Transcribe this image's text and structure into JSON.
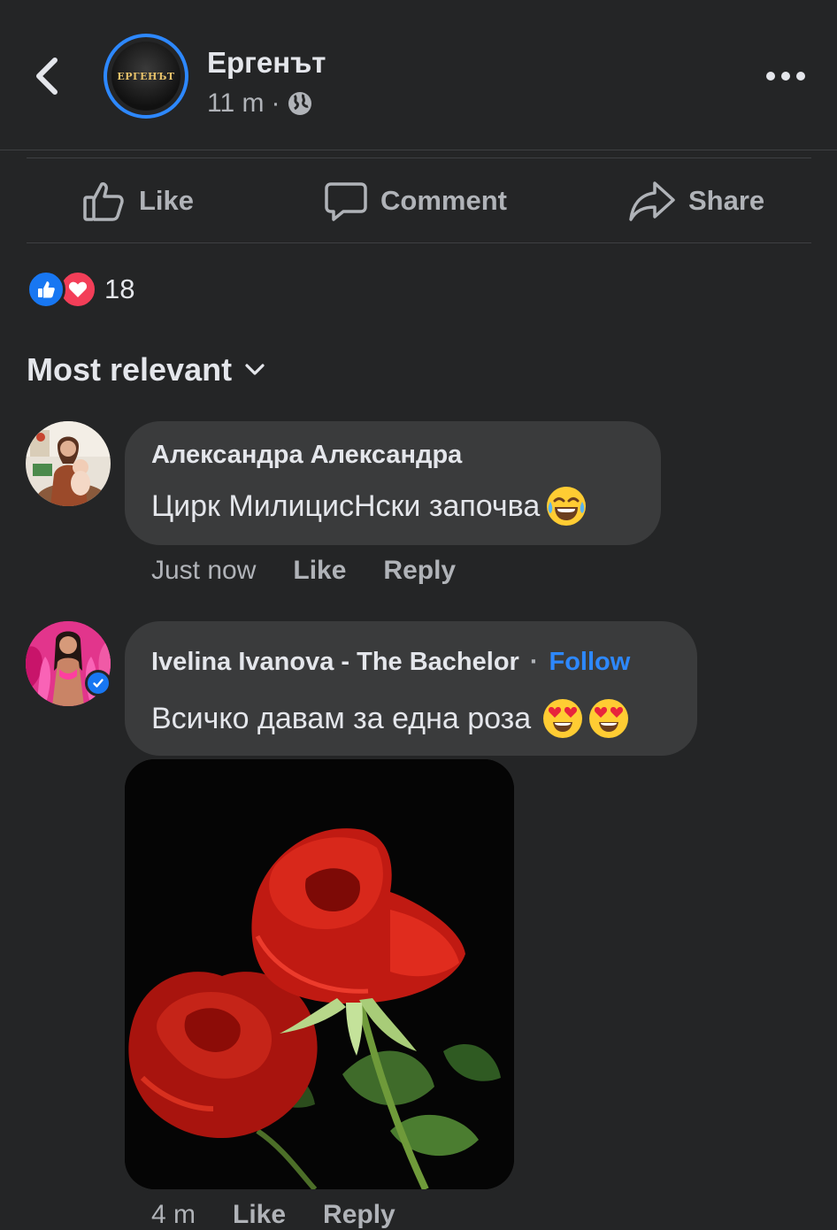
{
  "header": {
    "page_name": "Ергенът",
    "logo_text": "ЕРГЕНЪТ",
    "time": "11 m",
    "dot": "·",
    "privacy_icon": "globe-icon"
  },
  "actions": {
    "like": "Like",
    "comment": "Comment",
    "share": "Share"
  },
  "reactions": {
    "count": "18",
    "types": [
      "like",
      "love"
    ]
  },
  "sort": {
    "label": "Most relevant"
  },
  "comments": [
    {
      "author": "Александра Александра",
      "text": "Цирк МилицисНски започва",
      "emoji": [
        "face-with-tears-of-joy"
      ],
      "time": "Just now",
      "like": "Like",
      "reply": "Reply"
    },
    {
      "author": "Ivelina Ivanova - The Bachelor",
      "follow": "Follow",
      "dot": "·",
      "text": "Всичко давам за една роза",
      "emoji": [
        "heart-eyes",
        "heart-eyes"
      ],
      "time": "4 m",
      "like": "Like",
      "reply": "Reply",
      "attachment": "rose-photo"
    }
  ],
  "colors": {
    "background": "#242526",
    "bubble": "#3a3b3c",
    "accent": "#2d88ff",
    "text": "#e4e6eb",
    "secondary_text": "#b0b3b8"
  }
}
